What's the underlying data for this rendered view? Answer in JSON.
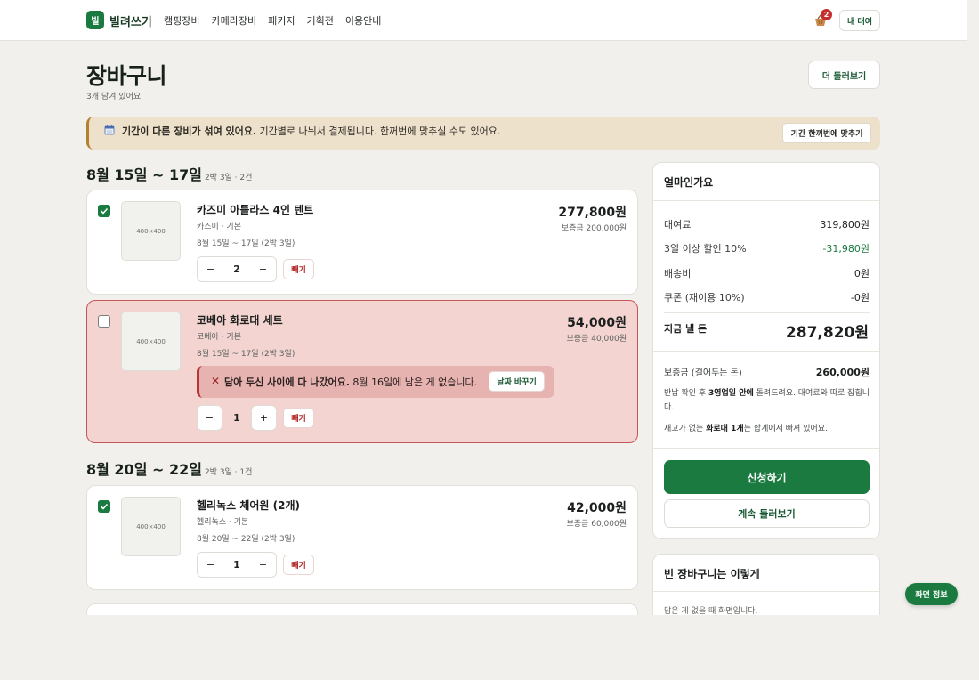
{
  "header": {
    "logo_mark": "빌",
    "brand": "빌려쓰기",
    "nav": [
      "캠핑장비",
      "카메라장비",
      "패키지",
      "기획전",
      "이용안내"
    ],
    "cart_count": "2",
    "my_rental": "내 대여"
  },
  "page": {
    "title": "장바구니",
    "subtitle": "3개 담겨 있어요",
    "browse_more": "더 둘러보기"
  },
  "notice": {
    "bold": "기간이 다른 장비가 섞여 있어요.",
    "text": " 기간별로 나뉘서 결제됩니다. 한꺼번에 맞추실 수도 있어요.",
    "button": "기간 한꺼번에 맞추기"
  },
  "groups": [
    {
      "title": "8월 15일 ~ 17일",
      "meta": "2박 3일 · 2건"
    },
    {
      "title": "8월 20일 ~ 22일",
      "meta": "2박 3일 · 1건"
    }
  ],
  "items": [
    {
      "thumb": "400×400",
      "name": "카즈미 아틀라스 4인 텐트",
      "brand": "카즈미 · 기본",
      "dates": "8월 15일 ~ 17일 (2박 3일)",
      "price": "277,800원",
      "deposit": "보증금 200,000원",
      "qty": "2",
      "remove": "빼기"
    },
    {
      "thumb": "400×400",
      "name": "코베아 화로대 세트",
      "brand": "코베아 · 기본",
      "dates": "8월 15일 ~ 17일 (2박 3일)",
      "price": "54,000원",
      "deposit": "보증금 40,000원",
      "qty": "1",
      "remove": "빼기",
      "sold_out_bold": "담아 두신 사이에 다 나갔어요.",
      "sold_out_text": " 8월 16일에 남은 게 없습니다.",
      "change_date": "날짜 바꾸기"
    },
    {
      "thumb": "400×400",
      "name": "헬리녹스 체어원 (2개)",
      "brand": "헬리녹스 · 기본",
      "dates": "8월 20일 ~ 22일 (2박 3일)",
      "price": "42,000원",
      "deposit": "보증금 60,000원",
      "qty": "1",
      "remove": "빼기"
    }
  ],
  "stepper": {
    "minus": "−",
    "plus": "+"
  },
  "summary": {
    "title": "얼마인가요",
    "rows": [
      {
        "label": "대여료",
        "value": "319,800원"
      },
      {
        "label": "3일 이상 할인 10%",
        "value": "-31,980원"
      },
      {
        "label": "배송비",
        "value": "0원"
      },
      {
        "label": "쿠폰 (재이용 10%)",
        "value": "-0원"
      }
    ],
    "total_label": "지금 낼 돈",
    "total_value": "287,820원",
    "deposit_label": "보증금 (걸어두는 돈)",
    "deposit_value": "260,000원",
    "note1_a": "반납 확인 후 ",
    "note1_b": "3영업일 안에",
    "note1_c": " 돌려드려요. 대여료와 따로 잡힙니다.",
    "note2_a": "재고가 없는 ",
    "note2_b": "화로대 1개",
    "note2_c": "는 합계에서 빠져 있어요.",
    "apply": "신청하기",
    "keep_browsing": "계속 둘러보기"
  },
  "empty": {
    "title": "빈 장바구니는 이렇게",
    "desc": "담은 게 없을 때 화면입니다."
  },
  "screen_info": "화면 정보",
  "colors": {
    "accent": "#1a7a40",
    "danger": "#c62d2d",
    "error_bg": "#f3d4d1",
    "notice_bg": "#eee1cc"
  }
}
